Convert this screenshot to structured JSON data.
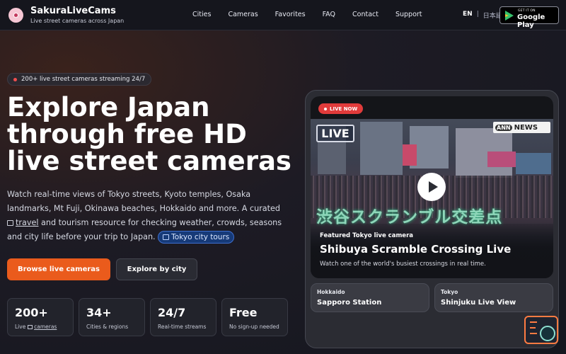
{
  "header": {
    "brand_name": "SakuraLiveCams",
    "brand_tagline": "Live street cameras across Japan",
    "nav": [
      "Cities",
      "Cameras",
      "Favorites",
      "FAQ",
      "Contact",
      "Support"
    ],
    "lang_en": "EN",
    "lang_sep": "|",
    "lang_jp": "日本語",
    "store_small": "GET IT ON",
    "store_big": "Google Play"
  },
  "hero": {
    "badge": "200+ live street cameras streaming 24/7",
    "title": "Explore Japan through free HD live street cameras",
    "desc_part1": "Watch real-time views of Tokyo streets, Kyoto temples, Osaka landmarks, Mt Fuji, Okinawa beaches, Hokkaido and more. A curated ",
    "desc_link": "travel",
    "desc_part2": " and tourism resource for checking weather, crowds, seasons and city life before your trip to Japan. ",
    "desc_pill": "Tokyo city tours",
    "btn_primary": "Browse live cameras",
    "btn_secondary": "Explore by city"
  },
  "stats": [
    {
      "value": "200+",
      "label_pre": "Live ",
      "label_link": "cameras"
    },
    {
      "value": "34+",
      "label": "Cities & regions"
    },
    {
      "value": "24/7",
      "label": "Real-time streams"
    },
    {
      "value": "Free",
      "label": "No sign-up needed"
    }
  ],
  "featured": {
    "live_now": "LIVE NOW",
    "live_overlay": "LIVE",
    "ann_badge": "ANN",
    "ann_news": "NEWS",
    "jp_overlay": "渋谷スクランブル交差点",
    "label": "Featured Tokyo live camera",
    "title": "Shibuya Scramble Crossing Live",
    "desc": "Watch one of the world's busiest crossings in real time."
  },
  "mini_cards": [
    {
      "region": "Hokkaido",
      "name": "Sapporo Station"
    },
    {
      "region": "Tokyo",
      "name": "Shinjuku Live View"
    }
  ],
  "colors": {
    "accent": "#ea5b1c",
    "live_red": "#e13b3b",
    "pill_blue": "#163a78"
  }
}
